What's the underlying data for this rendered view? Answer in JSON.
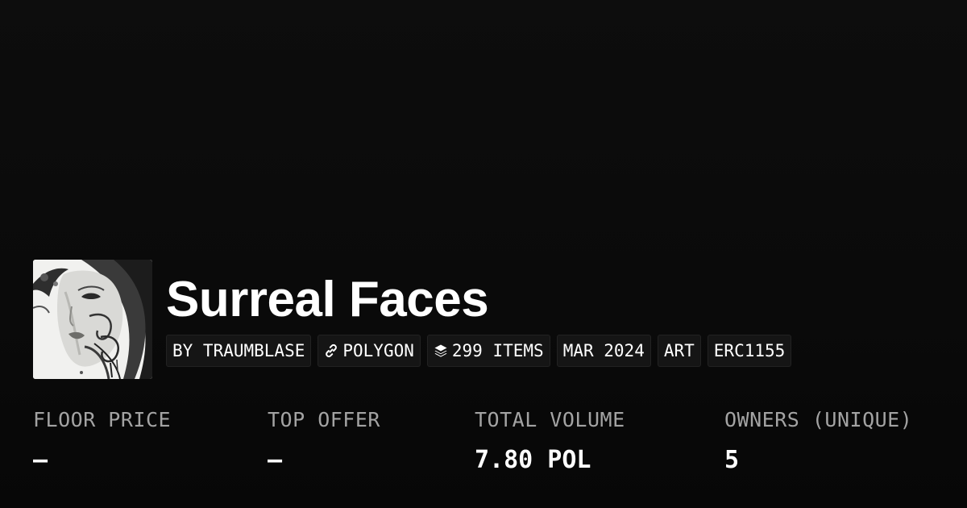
{
  "collection": {
    "name": "Surreal Faces",
    "image_icon": "portrait-artwork-icon"
  },
  "tags": [
    {
      "label": "BY TRAUMBLASE",
      "icon": ""
    },
    {
      "label": "POLYGON",
      "icon": "link-icon"
    },
    {
      "label": "299 ITEMS",
      "icon": "layers-icon"
    },
    {
      "label": "MAR 2024",
      "icon": ""
    },
    {
      "label": "ART",
      "icon": ""
    },
    {
      "label": "ERC1155",
      "icon": ""
    }
  ],
  "stats": [
    {
      "label": "FLOOR PRICE",
      "value": "–"
    },
    {
      "label": "TOP OFFER",
      "value": "–"
    },
    {
      "label": "TOTAL VOLUME",
      "value": "7.80 POL"
    },
    {
      "label": "OWNERS (UNIQUE)",
      "value": "5"
    }
  ],
  "colors": {
    "background": "#0b0b0b",
    "tag_background": "#151515",
    "label_gray": "#a3a3a3",
    "text": "#ffffff"
  }
}
